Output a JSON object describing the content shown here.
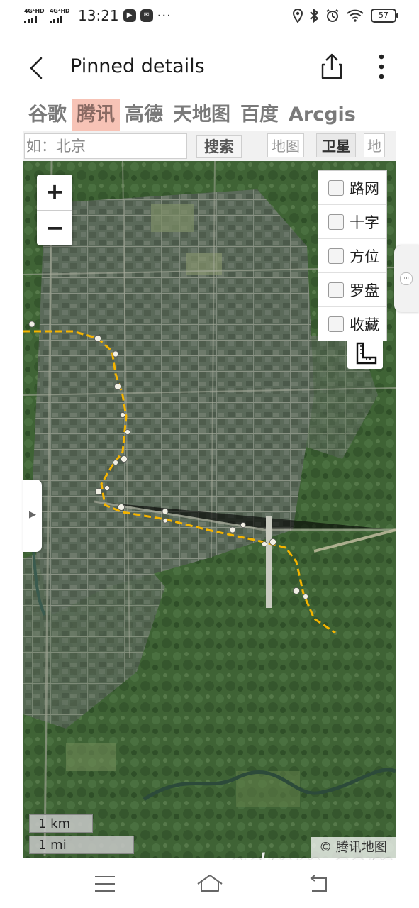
{
  "status_bar": {
    "network_1": "4G⁺HD",
    "network_2": "4G⁺HD",
    "time": "13:21",
    "more": "···",
    "battery": "57",
    "icons": [
      "location-icon",
      "bluetooth-icon",
      "alarm-icon",
      "wifi-icon",
      "battery-icon"
    ]
  },
  "header": {
    "title": "Pinned details",
    "icons": [
      "back-arrow-icon",
      "share-icon",
      "more-vert-icon"
    ]
  },
  "providers": [
    {
      "label": "谷歌",
      "active": false
    },
    {
      "label": "腾讯",
      "active": true
    },
    {
      "label": "高德",
      "active": false
    },
    {
      "label": "天地图",
      "active": false
    },
    {
      "label": "百度",
      "active": false
    },
    {
      "label": "Arcgis",
      "active": false
    }
  ],
  "search": {
    "placeholder": "如：北京",
    "button": "搜索"
  },
  "map_types": [
    {
      "label": "地图",
      "active": false
    },
    {
      "label": "卫星",
      "active": true
    },
    {
      "label": "地",
      "active": false
    }
  ],
  "zoom": {
    "in": "+",
    "out": "−"
  },
  "layers": [
    {
      "label": "路网",
      "checked": false
    },
    {
      "label": "十字",
      "checked": false
    },
    {
      "label": "方位",
      "checked": false
    },
    {
      "label": "罗盘",
      "checked": false
    },
    {
      "label": "收藏",
      "checked": false
    }
  ],
  "scale": {
    "km": "1 km",
    "mi": "1 mi"
  },
  "copyright": "© 腾讯地图",
  "watermark": "gdmm.com",
  "colors": {
    "route": "#f5b400",
    "active_tab": "#f7c3b6",
    "map_base": "#4d6a45"
  }
}
